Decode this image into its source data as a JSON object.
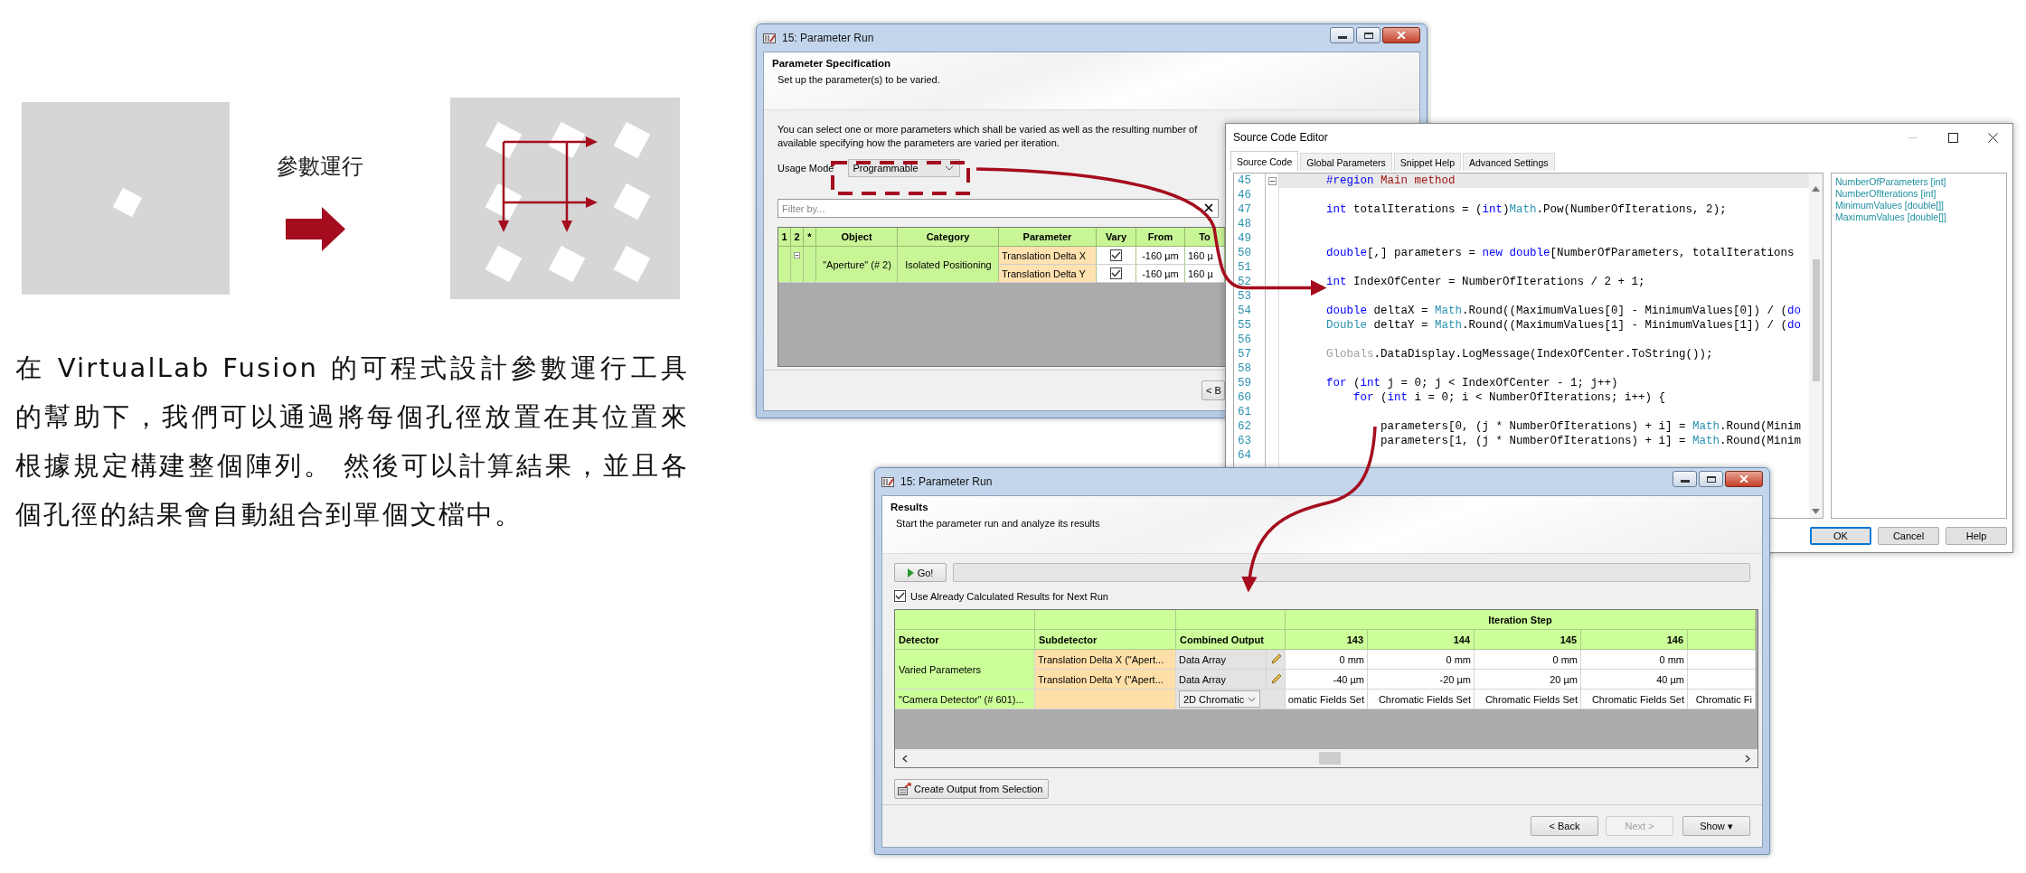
{
  "diagram": {
    "label": "參數運行"
  },
  "description": "在 VirtualLab Fusion 的可程式設計參數運行工具的幫助下，我們可以通過將每個孔徑放置在其位置來根據規定構建整個陣列。 然後可以計算結果，並且各個孔徑的結果會自動組合到單個文檔中。",
  "parameter_window": {
    "title": "15: Parameter Run",
    "section_title": "Parameter Specification",
    "section_subtitle": "Set up the parameter(s) to be varied.",
    "intro_lines": [
      "You can select one or more parameters which shall be varied as well as the resulting number of",
      "available specifying how the parameters are varied per iteration."
    ],
    "usage_mode": {
      "label": "Usage Mode",
      "value": "Programmable"
    },
    "filter": {
      "placeholder": "Filter by..."
    },
    "table": {
      "columns": [
        "1",
        "2",
        "*",
        "Object",
        "Category",
        "Parameter",
        "Vary",
        "From",
        "To"
      ],
      "rows": [
        {
          "object": "\"Aperture\" (# 2)",
          "category": "Isolated Positioning",
          "expanded": true,
          "parameters": [
            {
              "name": "Translation Delta X",
              "vary": true,
              "from": "-160 µm",
              "to": "160 µ"
            },
            {
              "name": "Translation Delta Y",
              "vary": true,
              "from": "-160 µm",
              "to": "160 µ"
            }
          ]
        }
      ]
    },
    "buttons": [
      "< B"
    ]
  },
  "editor_window": {
    "title": "Source Code Editor",
    "tabs": [
      {
        "label": "Source Code",
        "selected": true
      },
      {
        "label": "Global Parameters",
        "selected": false
      },
      {
        "label": "Snippet Help",
        "selected": false
      },
      {
        "label": "Advanced Settings",
        "selected": false
      }
    ],
    "code_lines": [
      {
        "number": "45",
        "current": true,
        "fold": true,
        "tokens": [
          {
            "kind": "keyword",
            "text": "#region"
          },
          {
            "kind": "region",
            "text": " Main method"
          }
        ]
      },
      {
        "number": "46",
        "current": false,
        "fold": false
      },
      {
        "number": "47",
        "current": false,
        "fold": false,
        "tokens": [
          {
            "kind": "keyword",
            "text": "int"
          },
          {
            "kind": "plain",
            "text": " totalIterations = ("
          },
          {
            "kind": "keyword",
            "text": "int"
          },
          {
            "kind": "plain",
            "text": ")"
          },
          {
            "kind": "type",
            "text": "Math"
          },
          {
            "kind": "plain",
            "text": ".Pow(NumberOfIterations, 2);"
          }
        ]
      },
      {
        "number": "48",
        "current": false,
        "fold": false
      },
      {
        "number": "49",
        "current": false,
        "fold": false
      },
      {
        "number": "50",
        "current": false,
        "fold": false,
        "tokens": [
          {
            "kind": "keyword",
            "text": "double"
          },
          {
            "kind": "plain",
            "text": "[,] parameters = "
          },
          {
            "kind": "keyword",
            "text": "new double"
          },
          {
            "kind": "plain",
            "text": "[NumberOfParameters, totalIterations"
          }
        ]
      },
      {
        "number": "51",
        "current": false,
        "fold": false
      },
      {
        "number": "52",
        "current": false,
        "fold": false,
        "tokens": [
          {
            "kind": "keyword",
            "text": "int"
          },
          {
            "kind": "plain",
            "text": " IndexOfCenter = NumberOfIterations / 2 + 1;"
          }
        ]
      },
      {
        "number": "53",
        "current": false,
        "fold": false
      },
      {
        "number": "54",
        "current": false,
        "fold": false,
        "tokens": [
          {
            "kind": "keyword",
            "text": "double"
          },
          {
            "kind": "plain",
            "text": " deltaX = "
          },
          {
            "kind": "type",
            "text": "Math"
          },
          {
            "kind": "plain",
            "text": ".Round((MaximumValues[0] - MinimumValues[0]) / ("
          },
          {
            "kind": "keyword",
            "text": "do"
          }
        ]
      },
      {
        "number": "55",
        "current": false,
        "fold": false,
        "tokens": [
          {
            "kind": "type",
            "text": "Double"
          },
          {
            "kind": "plain",
            "text": " deltaY = "
          },
          {
            "kind": "type",
            "text": "Math"
          },
          {
            "kind": "plain",
            "text": ".Round((MaximumValues[1] - MinimumValues[1]) / ("
          },
          {
            "kind": "keyword",
            "text": "do"
          }
        ]
      },
      {
        "number": "56",
        "current": false,
        "fold": false
      },
      {
        "number": "57",
        "current": false,
        "fold": false,
        "tokens": [
          {
            "kind": "muted",
            "text": "Globals"
          },
          {
            "kind": "plain",
            "text": ".DataDisplay.LogMessage(IndexOfCenter.ToString());"
          }
        ]
      },
      {
        "number": "58",
        "current": false,
        "fold": false
      },
      {
        "number": "59",
        "current": false,
        "fold": false,
        "tokens": [
          {
            "kind": "keyword",
            "text": "for"
          },
          {
            "kind": "plain",
            "text": " ("
          },
          {
            "kind": "keyword",
            "text": "int"
          },
          {
            "kind": "plain",
            "text": " j = 0; j < IndexOfCenter - 1; j++)"
          }
        ]
      },
      {
        "number": "60",
        "current": false,
        "fold": false,
        "tokens": [
          {
            "kind": "keyword",
            "text": "    for"
          },
          {
            "kind": "plain",
            "text": " ("
          },
          {
            "kind": "keyword",
            "text": "int"
          },
          {
            "kind": "plain",
            "text": " i = 0; i < NumberOfIterations; i++) {"
          }
        ]
      },
      {
        "number": "61",
        "current": false,
        "fold": false
      },
      {
        "number": "62",
        "current": false,
        "fold": false,
        "tokens": [
          {
            "kind": "plain",
            "text": "        parameters[0, (j * NumberOfIterations) + i] = "
          },
          {
            "kind": "type",
            "text": "Math"
          },
          {
            "kind": "plain",
            "text": ".Round(Minim"
          }
        ]
      },
      {
        "number": "63",
        "current": false,
        "fold": false,
        "tokens": [
          {
            "kind": "plain",
            "text": "        parameters[1, (j * NumberOfIterations) + i] = "
          },
          {
            "kind": "type",
            "text": "Math"
          },
          {
            "kind": "plain",
            "text": ".Round(Minim"
          }
        ]
      },
      {
        "number": "64",
        "current": false,
        "fold": false
      }
    ],
    "variables": [
      "NumberOfParameters [int]",
      "NumberOfIterations [int]",
      "MinimumValues [double[]]",
      "MaximumValues [double[]]"
    ],
    "buttons": [
      "OK",
      "Cancel",
      "Help"
    ]
  },
  "results_window": {
    "title": "15: Parameter Run",
    "section_title": "Results",
    "section_subtitle": "Start the parameter run and analyze its results",
    "go_button": "Go!",
    "progress": {
      "level": 0
    },
    "reuse_results": {
      "label": "Use Already Calculated Results for Next Run",
      "checked": true
    },
    "table": {
      "group_header": "Iteration Step",
      "columns": [
        "Detector",
        "Subdetector",
        "Combined Output"
      ],
      "steps": [
        "143",
        "144",
        "145",
        "146"
      ],
      "rows": [
        {
          "detector": "Varied Parameters",
          "subrows": [
            {
              "subdetector": "Translation Delta X (\"Apert...",
              "output": {
                "kind": "field",
                "text": "Data Array"
              },
              "values": [
                "0 mm",
                "0 mm",
                "0 mm",
                "0 mm"
              ]
            },
            {
              "subdetector": "Translation Delta Y (\"Apert...",
              "output": {
                "kind": "field",
                "text": "Data Array"
              },
              "values": [
                "-40 µm",
                "-20 µm",
                "20 µm",
                "40 µm"
              ]
            }
          ]
        },
        {
          "detector": "\"Camera Detector\" (# 601)...",
          "subrows": [
            {
              "output": {
                "kind": "dropdown",
                "text": "2D Chromatic"
              },
              "values": [
                "omatic Fields Set",
                "Chromatic Fields Set",
                "Chromatic Fields Set",
                "Chromatic Fields Set",
                "Chromatic Fi"
              ]
            }
          ]
        }
      ]
    },
    "create_button": "Create Output from Selection",
    "buttons": [
      {
        "label": "< Back",
        "disabled": false
      },
      {
        "label": "Next >",
        "disabled": true
      },
      {
        "label": "Show ▾",
        "disabled": false
      }
    ]
  }
}
